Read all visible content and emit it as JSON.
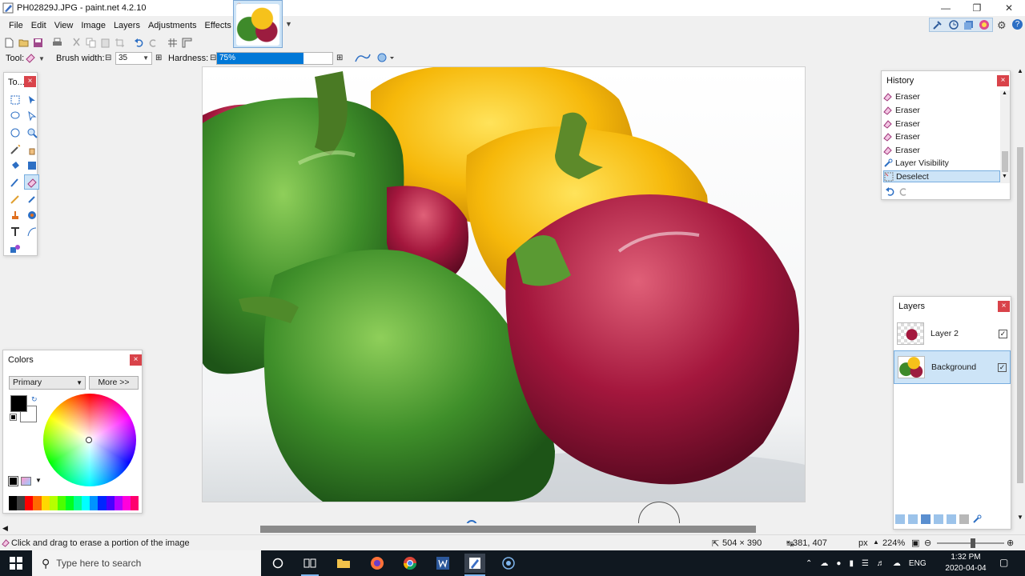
{
  "window": {
    "title": "PH02829J.JPG - paint.net 4.2.10"
  },
  "menu": [
    "File",
    "Edit",
    "View",
    "Image",
    "Layers",
    "Adjustments",
    "Effects"
  ],
  "tool_options": {
    "tool_label": "Tool:",
    "brush_width_label": "Brush width:",
    "brush_width_value": "35",
    "hardness_label": "Hardness:",
    "hardness_value": "75%",
    "hardness_fraction": 0.75
  },
  "panels": {
    "tools": {
      "title": "To...",
      "close": "×"
    },
    "history": {
      "title": "History",
      "close": "×",
      "items": [
        {
          "label": "Eraser",
          "icon": "eraser-icon"
        },
        {
          "label": "Eraser",
          "icon": "eraser-icon"
        },
        {
          "label": "Eraser",
          "icon": "eraser-icon"
        },
        {
          "label": "Eraser",
          "icon": "eraser-icon"
        },
        {
          "label": "Eraser",
          "icon": "eraser-icon"
        },
        {
          "label": "Layer Visibility",
          "icon": "wrench-icon"
        },
        {
          "label": "Deselect",
          "icon": "deselect-icon",
          "selected": true
        }
      ]
    },
    "layers": {
      "title": "Layers",
      "close": "×",
      "items": [
        {
          "name": "Layer 2",
          "visible": true,
          "selected": false
        },
        {
          "name": "Background",
          "visible": true,
          "selected": true
        }
      ]
    },
    "colors": {
      "title": "Colors",
      "close": "×",
      "mode": "Primary",
      "more_button": "More >>",
      "primary_color": "#000000",
      "secondary_color": "#ffffff",
      "palette": [
        "#000000",
        "#404040",
        "#ff0000",
        "#ff6a00",
        "#ffd800",
        "#b6ff00",
        "#4cff00",
        "#00ff21",
        "#00ff90",
        "#00ffff",
        "#0094ff",
        "#0026ff",
        "#4800ff",
        "#b200ff",
        "#ff00dc",
        "#ff006e"
      ]
    }
  },
  "status": {
    "hint": "Click and drag to erase a portion of the image",
    "size": "504 × 390",
    "cursor": "381, 407",
    "unit": "px",
    "zoom": "224%"
  },
  "taskbar": {
    "search_placeholder": "Type here to search",
    "lang": "ENG",
    "time": "1:32 PM",
    "date": "2020-04-04"
  },
  "colors": {
    "accent": "#0078d7",
    "selection": "#cde4f7",
    "close": "#d9434a"
  }
}
